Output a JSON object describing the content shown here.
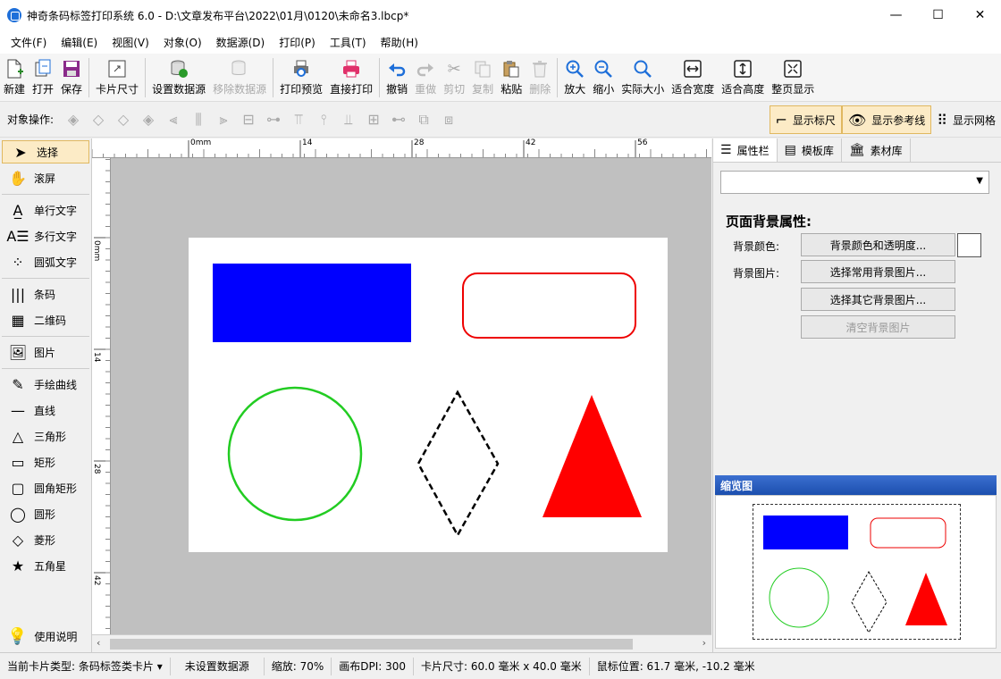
{
  "window": {
    "title": "神奇条码标签打印系统 6.0 - D:\\文章发布平台\\2022\\01月\\0120\\未命名3.lbcp*",
    "minimize": "—",
    "maximize": "☐",
    "close": "✕"
  },
  "menu": [
    "文件(F)",
    "编辑(E)",
    "视图(V)",
    "对象(O)",
    "数据源(D)",
    "打印(P)",
    "工具(T)",
    "帮助(H)"
  ],
  "toolbar": {
    "new": "新建",
    "open": "打开",
    "save": "保存",
    "card_size": "卡片尺寸",
    "set_datasource": "设置数据源",
    "remove_datasource": "移除数据源",
    "print_preview": "打印预览",
    "direct_print": "直接打印",
    "undo": "撤销",
    "redo": "重做",
    "cut": "剪切",
    "copy": "复制",
    "paste": "粘贴",
    "delete": "删除",
    "zoom_in": "放大",
    "zoom_out": "缩小",
    "actual_size": "实际大小",
    "fit_width": "适合宽度",
    "fit_height": "适合高度",
    "fit_page": "整页显示"
  },
  "ops_bar": {
    "label": "对象操作:",
    "show_ruler": "显示标尺",
    "show_guides": "显示参考线",
    "show_grid": "显示网格"
  },
  "left_tools": {
    "select": "选择",
    "scroll": "滚屏",
    "single_text": "单行文字",
    "multi_text": "多行文字",
    "arc_text": "圆弧文字",
    "barcode": "条码",
    "qrcode": "二维码",
    "image": "图片",
    "freehand": "手绘曲线",
    "line": "直线",
    "triangle": "三角形",
    "rectangle": "矩形",
    "rounded_rect": "圆角矩形",
    "circle": "圆形",
    "diamond": "菱形",
    "star": "五角星",
    "help": "使用说明"
  },
  "ruler": {
    "top_labels": [
      "0mm",
      "14",
      "28",
      "42",
      "56"
    ],
    "left_labels": [
      "0mm",
      "14",
      "28",
      "42"
    ]
  },
  "right_panel": {
    "tabs": [
      "属性栏",
      "模板库",
      "素材库"
    ],
    "section_title": "页面背景属性:",
    "bg_color_label": "背景颜色:",
    "bg_image_label": "背景图片:",
    "btn_color": "背景颜色和透明度...",
    "btn_common_bg": "选择常用背景图片...",
    "btn_other_bg": "选择其它背景图片...",
    "btn_clear_bg": "清空背景图片",
    "thumbnail_title": "缩览图"
  },
  "shapes": {
    "rect_color": "#0000ff",
    "rounded_rect_color": "#ee0000",
    "circle_color": "#22cc22",
    "diamond_color": "#000000",
    "triangle_color": "#ff0000"
  },
  "status": {
    "card_type": "当前卡片类型: 条码标签类卡片",
    "datasource": "未设置数据源",
    "zoom": "缩放: 70%",
    "dpi": "画布DPI: 300",
    "card_size": "卡片尺寸: 60.0 毫米 x 40.0 毫米",
    "mouse_pos": "鼠标位置: 61.7 毫米, -10.2 毫米"
  }
}
